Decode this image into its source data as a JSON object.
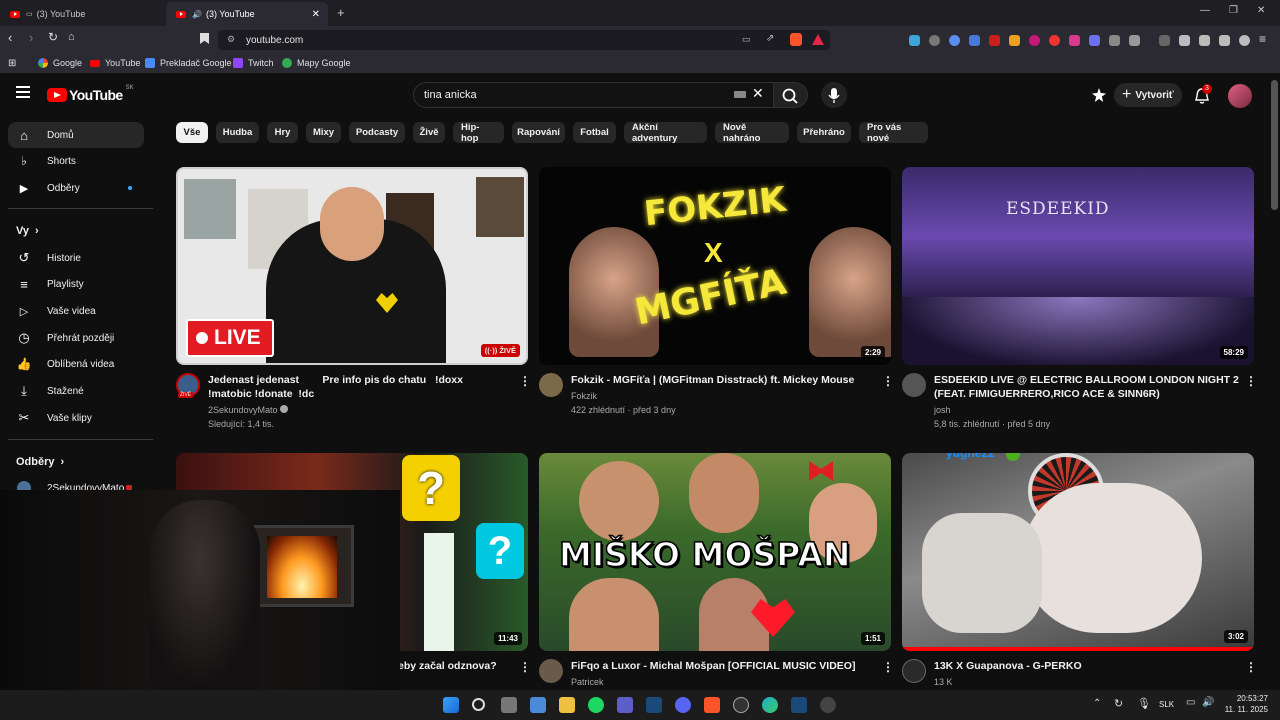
{
  "browser": {
    "tabs": [
      {
        "title": "(3) YouTube"
      },
      {
        "title": "(3) YouTube"
      }
    ],
    "url": "youtube.com",
    "bookmarks": [
      {
        "label": "Google"
      },
      {
        "label": "YouTube"
      },
      {
        "label": "Prekladač Google"
      },
      {
        "label": "Twitch"
      },
      {
        "label": "Mapy Google"
      }
    ]
  },
  "youtube": {
    "logo_text": "YouTube",
    "country_code": "SK",
    "search": {
      "value": "tina anicka"
    },
    "create_label": "Vytvoriť",
    "notification_count": "3"
  },
  "sidebar": {
    "items": [
      {
        "label": "Domů"
      },
      {
        "label": "Shorts"
      },
      {
        "label": "Odběry"
      }
    ],
    "you_heading": "Vy",
    "you_items": [
      {
        "label": "Historie"
      },
      {
        "label": "Playlisty"
      },
      {
        "label": "Vaše videa"
      },
      {
        "label": "Přehrát později"
      },
      {
        "label": "Oblíbená videa"
      },
      {
        "label": "Stažené"
      },
      {
        "label": "Vaše klipy"
      }
    ],
    "subs_heading": "Odběry",
    "subs": [
      {
        "label": "2SekundovyMato"
      }
    ]
  },
  "chips": [
    {
      "label": "Vše"
    },
    {
      "label": "Hudba"
    },
    {
      "label": "Hry"
    },
    {
      "label": "Mixy"
    },
    {
      "label": "Podcasty"
    },
    {
      "label": "Živě"
    },
    {
      "label": "Hip-hop"
    },
    {
      "label": "Rapování"
    },
    {
      "label": "Fotbal"
    },
    {
      "label": "Akční adventury"
    },
    {
      "label": "Nově nahráno"
    },
    {
      "label": "Přehráno"
    },
    {
      "label": "Pro vás nové"
    }
  ],
  "videos": [
    {
      "title": "Jedenast jedenast        Pre info pis do chatu   !doxx  !matobic !donate  !dc",
      "channel": "2SekundovyMato",
      "meta": "Sledující: 1,4 tis.",
      "badge": "ŽIVĚ",
      "thumb_text": "LIVE",
      "avatar_badge": "ŽIVĚ"
    },
    {
      "title": "Fokzik - MGFíťa  | (MGFitman Disstrack) ft. Mickey Mouse",
      "channel": "Fokzik",
      "meta": "422 zhlédnutí · před 3 dny",
      "duration": "2:29",
      "thumb_text_1": "FOKZIK",
      "thumb_text_2": "X",
      "thumb_text_3": "MGFÍŤA"
    },
    {
      "title": "ESDEEKID LIVE @ ELECTRIC BALLROOM LONDON NIGHT 2 (FEAT. FIMIGUERRERO,RICO ACE & SINN6R)",
      "channel": "josh",
      "meta": "5,8 tis. zhlédnutí · před 5 dny",
      "duration": "58:29",
      "thumb_text": "ESDEEKID"
    },
    {
      "title": "eby začal odznova?",
      "duration": "11:43"
    },
    {
      "title": "FiFqo a Luxor - Michal Mošpan [OFFICIAL MUSIC VIDEO]",
      "channel": "Patricek",
      "duration": "1:51",
      "thumb_text": "MIŠKO MOŠPAN"
    },
    {
      "title": "13K X Guapanova - G-PERKO",
      "channel": "13 K",
      "duration": "3:02",
      "thumb_text": "yughe22"
    }
  ],
  "taskbar": {
    "language": "SLK",
    "time": "20:53:27",
    "date": "11. 11. 2025"
  }
}
